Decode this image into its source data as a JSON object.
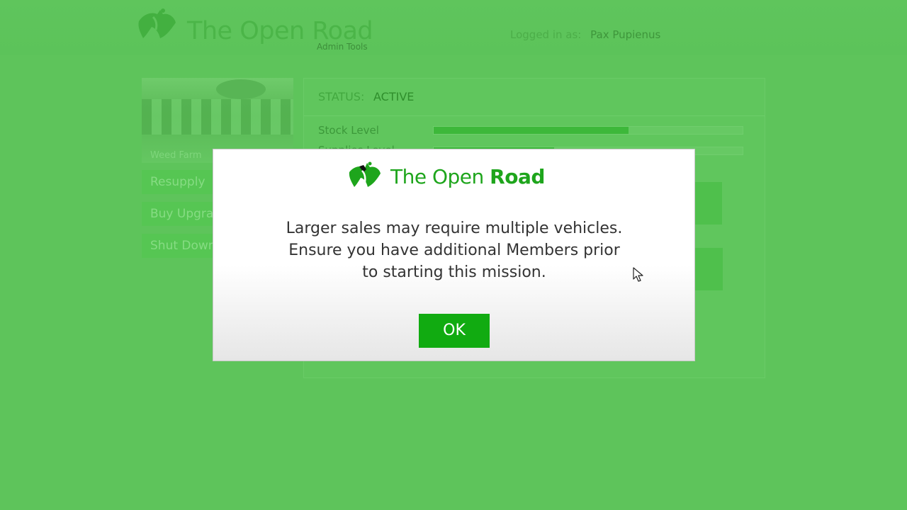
{
  "header": {
    "brand_title": "The Open Road",
    "brand_subtitle": "Admin Tools",
    "logged_in_label": "Logged in as:",
    "logged_in_user": "Pax Pupienus"
  },
  "sidebar": {
    "thumbnail_caption": "Weed Farm",
    "buttons": [
      {
        "label": "Resupply"
      },
      {
        "label": "Buy Upgrades"
      },
      {
        "label": "Shut Down"
      }
    ]
  },
  "panel": {
    "status_label": "STATUS:",
    "status_value": "ACTIVE",
    "bars": [
      {
        "label": "Stock Level",
        "fill_fraction": 0.63
      },
      {
        "label": "Supplies Level",
        "fill_fraction": 0.39
      }
    ]
  },
  "dialog": {
    "brand_title_light": "The Open ",
    "brand_title_bold": "Road",
    "message_lines": [
      "Larger sales may require multiple vehicles.",
      "Ensure you have additional Members prior",
      "to starting this mission."
    ],
    "ok_label": "OK"
  },
  "colors": {
    "background": "#5ec45b",
    "accent": "#11ab11",
    "dialog_text": "#333333"
  },
  "icons": {
    "brand_logo": "open-road-logo-icon",
    "pointer": "mouse-cursor-icon"
  }
}
